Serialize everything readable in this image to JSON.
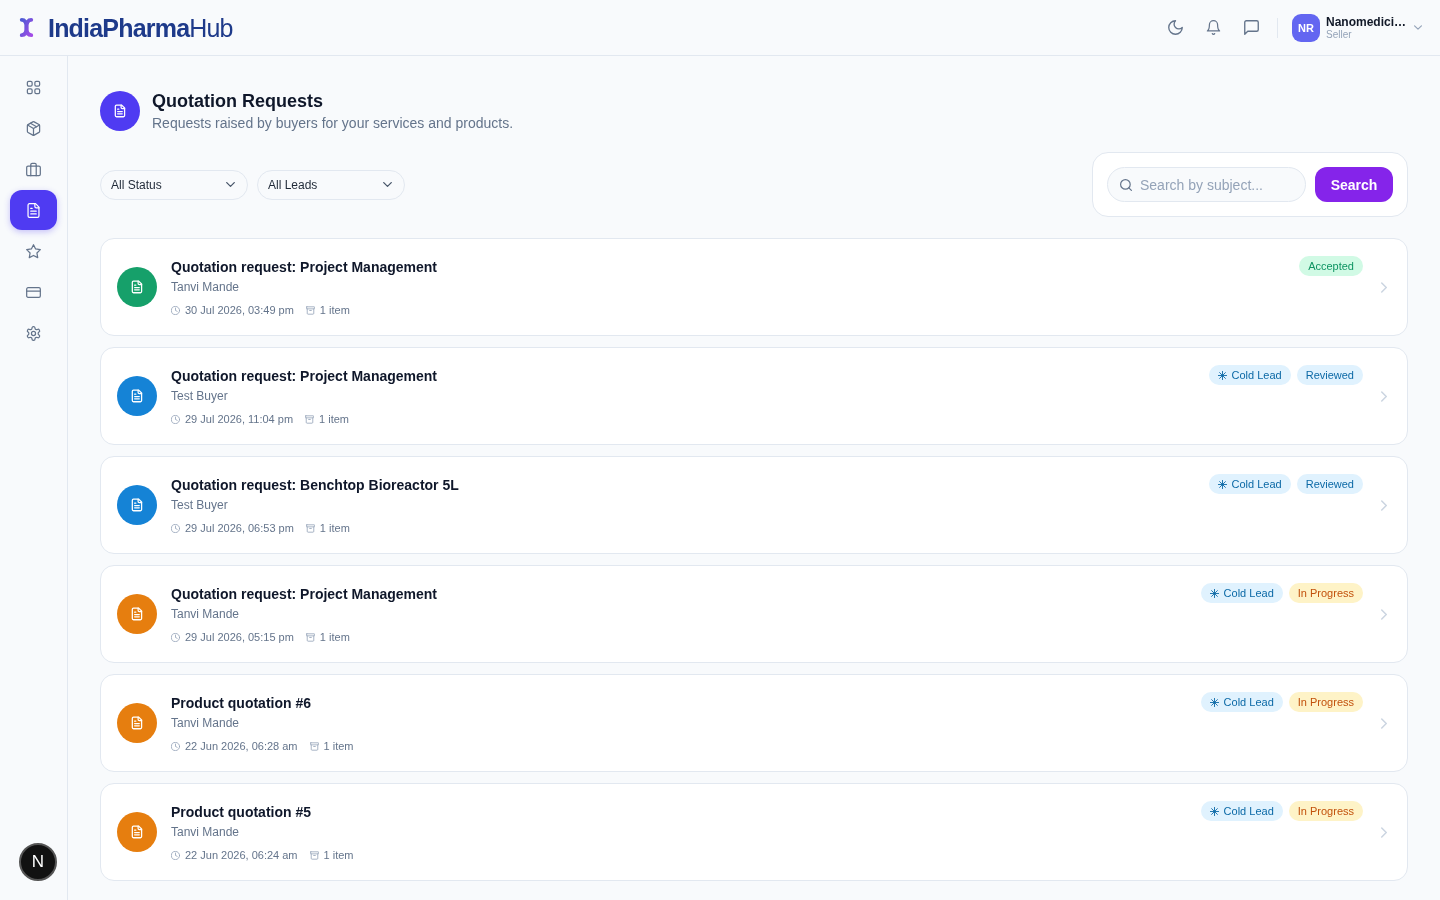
{
  "header": {
    "brand": "**IndiaPharma**Hub",
    "user": {
      "initials": "NR",
      "name": "Nanomedici…",
      "role": "Seller"
    }
  },
  "sidebar": {
    "items": [
      {
        "kind": "dashboard",
        "selected": false
      },
      {
        "kind": "products",
        "selected": false
      },
      {
        "kind": "services",
        "selected": false
      },
      {
        "kind": "quotations",
        "selected": true
      },
      {
        "kind": "reviews",
        "selected": false
      },
      {
        "kind": "payments",
        "selected": false
      },
      {
        "kind": "settings",
        "selected": false
      }
    ]
  },
  "dev_indicator": {
    "letter": "N"
  },
  "page": {
    "title": "Quotation Requests",
    "subtitle": "Requests raised by buyers for your services and products."
  },
  "filters": [
    {
      "value": "All Status"
    },
    {
      "value": "All Leads"
    }
  ],
  "search": {
    "placeholder": "Search by subject...",
    "button": "Search"
  },
  "requests": [
    {
      "title": "Quotation request: Project Management",
      "buyer": "Tanvi Mande",
      "date": "30 Jul 2026, 03:49 pm",
      "items": "1 item",
      "status": {
        "label": "Accepted",
        "kind": "accepted"
      }
    },
    {
      "title": "Quotation request: Project Management",
      "buyer": "Test Buyer",
      "date": "29 Jul 2026, 11:04 pm",
      "items": "1 item",
      "lead": "Cold Lead",
      "status": {
        "label": "Reviewed",
        "kind": "reviewed"
      }
    },
    {
      "title": "Quotation request: Benchtop Bioreactor 5L",
      "buyer": "Test Buyer",
      "date": "29 Jul 2026, 06:53 pm",
      "items": "1 item",
      "lead": "Cold Lead",
      "status": {
        "label": "Reviewed",
        "kind": "reviewed"
      }
    },
    {
      "title": "Quotation request: Project Management",
      "buyer": "Tanvi Mande",
      "date": "29 Jul 2026, 05:15 pm",
      "items": "1 item",
      "lead": "Cold Lead",
      "status": {
        "label": "In Progress",
        "kind": "in_progress"
      }
    },
    {
      "title": "Product quotation #6",
      "buyer": "Tanvi Mande",
      "date": "22 Jun 2026, 06:28 am",
      "items": "1 item",
      "lead": "Cold Lead",
      "status": {
        "label": "In Progress",
        "kind": "in_progress"
      }
    },
    {
      "title": "Product quotation #5",
      "buyer": "Tanvi Mande",
      "date": "22 Jun 2026, 06:24 am",
      "items": "1 item",
      "lead": "Cold Lead",
      "status": {
        "label": "In Progress",
        "kind": "in_progress"
      }
    }
  ]
}
